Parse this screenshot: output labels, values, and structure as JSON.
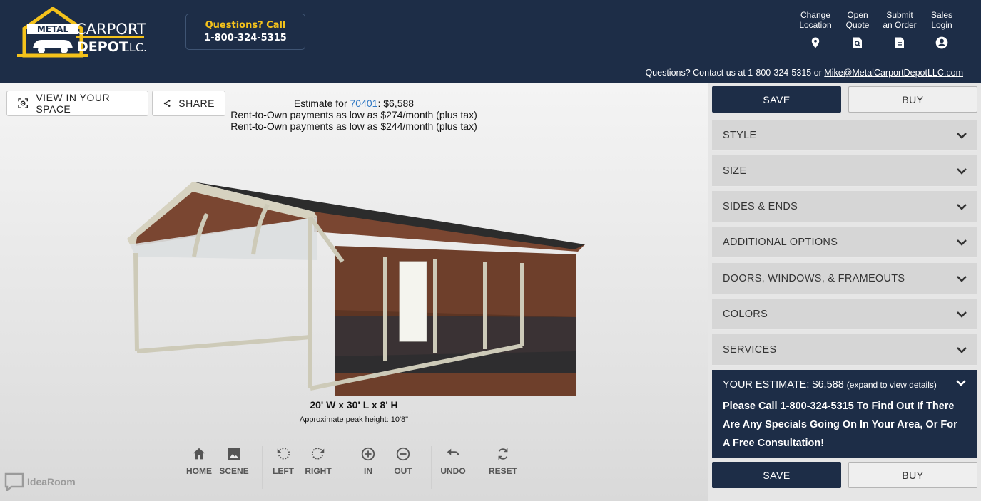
{
  "header": {
    "logo_text": "METAL CARPORT DEPOT LLC",
    "call_line1": "Questions? Call",
    "call_line2": "1-800-324-5315",
    "nav": [
      {
        "line1": "Change",
        "line2": "Location",
        "icon": "location-pin-icon"
      },
      {
        "line1": "Open",
        "line2": "Quote",
        "icon": "search-document-icon"
      },
      {
        "line1": "Submit",
        "line2": "an Order",
        "icon": "document-icon"
      },
      {
        "line1": "Sales",
        "line2": "Login",
        "icon": "account-circle-icon"
      }
    ],
    "contact_text": "Questions? Contact us at 1-800-324-5315 or ",
    "contact_email": "Mike@MetalCarportDepotLLC.com"
  },
  "viewer": {
    "view_in_space": "VIEW IN YOUR SPACE",
    "share": "SHARE",
    "estimate_prefix": "Estimate for ",
    "zip": "70401",
    "estimate_suffix": ": $6,588",
    "rto_line1": "Rent-to-Own payments as low as $274/month (plus tax)",
    "rto_line2": "Rent-to-Own payments as low as $244/month (plus tax)",
    "dimensions": "20' W x 30' L x 8' H",
    "peak_height": "Approximate peak height: 10'8\"",
    "tools": [
      {
        "label": "HOME",
        "icon": "home-icon"
      },
      {
        "label": "SCENE",
        "icon": "image-icon"
      },
      {
        "label": "LEFT",
        "icon": "rotate-left-icon"
      },
      {
        "label": "RIGHT",
        "icon": "rotate-right-icon"
      },
      {
        "label": "IN",
        "icon": "zoom-in-icon"
      },
      {
        "label": "OUT",
        "icon": "zoom-out-icon"
      },
      {
        "label": "UNDO",
        "icon": "undo-icon"
      },
      {
        "label": "RESET",
        "icon": "reset-icon"
      }
    ],
    "brand": "IdeaRoom"
  },
  "panel": {
    "save": "SAVE",
    "buy": "BUY",
    "sections": [
      "STYLE",
      "SIZE",
      "SIDES & ENDS",
      "ADDITIONAL OPTIONS",
      "DOORS, WINDOWS, & FRAMEOUTS",
      "COLORS",
      "SERVICES"
    ],
    "estimate_label": "YOUR ESTIMATE: $6,588",
    "estimate_note": "(expand to view details)",
    "estimate_msg": "Please Call 1-800-324-5315 To Find Out If There Are Any Specials Going On In Your Area, Or For A Free Consultation!"
  },
  "colors": {
    "navy": "#1d2d47",
    "accent_yellow": "#f4c21b",
    "link_blue": "#2f78c4"
  }
}
